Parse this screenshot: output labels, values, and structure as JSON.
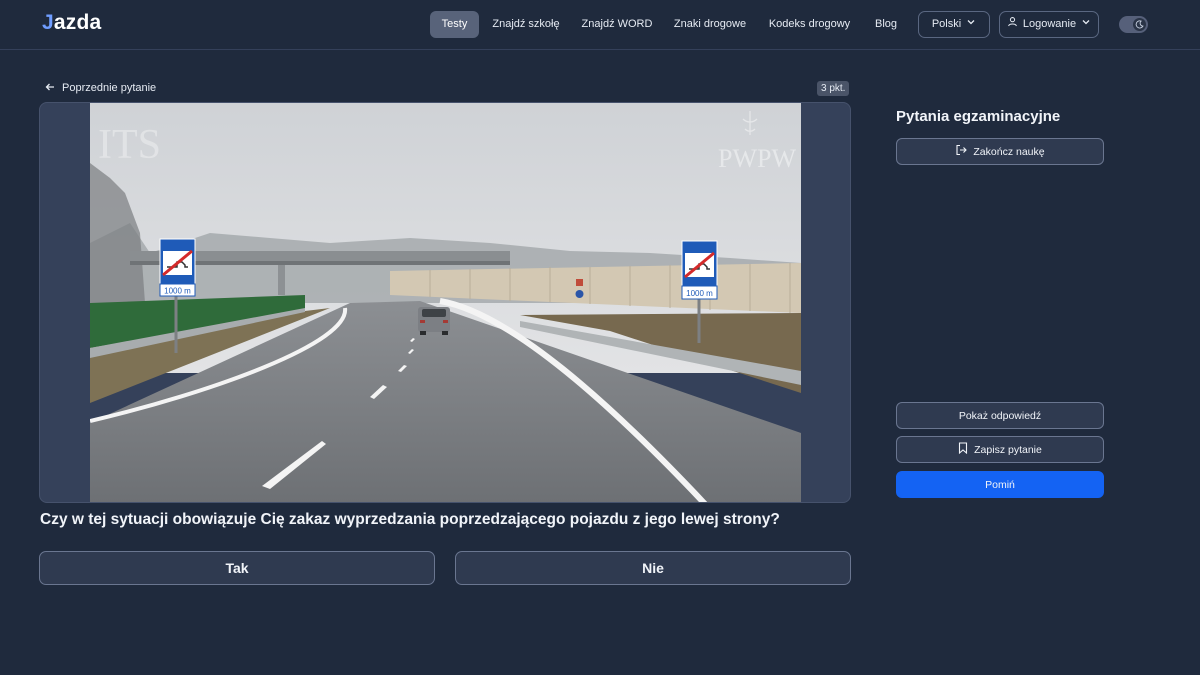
{
  "header": {
    "logo_mark": "J",
    "logo_rest": "azda",
    "nav": [
      {
        "label": "Testy",
        "active": true
      },
      {
        "label": "Znajdź szkołę"
      },
      {
        "label": "Znajdź WORD"
      },
      {
        "label": "Znaki drogowe"
      },
      {
        "label": "Kodeks drogowy"
      },
      {
        "label": "Blog"
      }
    ],
    "language": "Polski",
    "login": "Logowanie",
    "theme_toggle_icon": "moon-icon"
  },
  "main": {
    "back_label": "Poprzednie pytanie",
    "points": "3 pkt.",
    "image": {
      "sign_distance": "1000 m",
      "watermark_left": "ITS",
      "watermark_right": "PWPW"
    },
    "question": "Czy w tej sytuacji obowiązuje Cię zakaz wyprzedzania poprzedzającego pojazdu z jego lewej strony?",
    "answers": [
      "Tak",
      "Nie"
    ]
  },
  "sidebar": {
    "title": "Pytania egzaminacyjne",
    "finish_label": "Zakończ naukę",
    "show_answer_label": "Pokaż odpowiedź",
    "save_label": "Zapisz pytanie",
    "skip_label": "Pomiń"
  },
  "colors": {
    "background": "#1f2a3d",
    "accent": "#1463f3",
    "logo_accent": "#6f9dff",
    "sign_blue": "#1f5bb8",
    "sign_strike": "#d42a2a"
  }
}
